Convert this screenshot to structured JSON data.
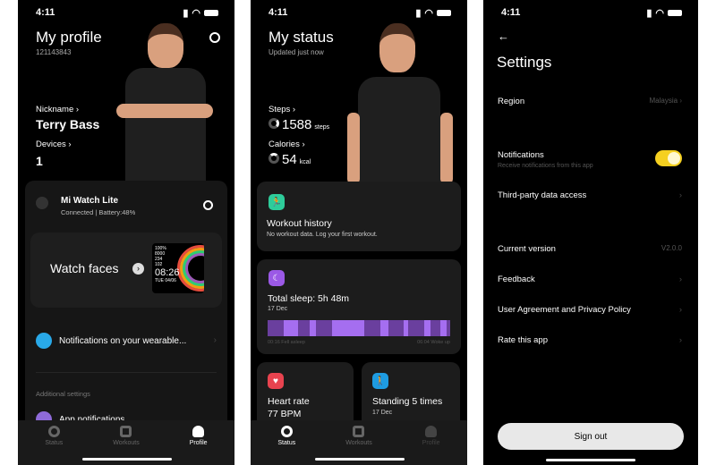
{
  "status_bar": {
    "time": "4:11"
  },
  "profile": {
    "title": "My profile",
    "user_id": "121143843",
    "nickname_label": "Nickname",
    "nickname": "Terry Bass",
    "devices_label": "Devices",
    "devices_count": "1",
    "device": {
      "name": "Mi Watch Lite",
      "status": "Connected | Battery:48%"
    },
    "watch_faces": {
      "label": "Watch faces",
      "preview": {
        "battery": "100%",
        "steps": "8000",
        "kcal": "234",
        "hr": "102",
        "time": "08:26",
        "date": "TUE 04/06"
      }
    },
    "notifications_label": "Notifications on your wearable...",
    "additional_label": "Additional settings",
    "app_notifications": "App notifications"
  },
  "status": {
    "title": "My status",
    "updated": "Updated just now",
    "steps_label": "Steps",
    "steps": "1588",
    "steps_unit": "steps",
    "calories_label": "Calories",
    "calories": "54",
    "calories_unit": "kcal",
    "workout": {
      "title": "Workout history",
      "sub": "No workout data. Log your first workout."
    },
    "sleep": {
      "title": "Total sleep: 5h 48m",
      "date": "17 Dec",
      "start": "00:16 Fell asleep",
      "end": "06:04 Woke up"
    },
    "heart": {
      "title": "Heart rate",
      "value": "77 BPM"
    },
    "standing": {
      "title": "Standing 5 times",
      "date": "17 Dec"
    }
  },
  "tabs": [
    {
      "label": "Status"
    },
    {
      "label": "Workouts"
    },
    {
      "label": "Profile"
    }
  ],
  "settings": {
    "title": "Settings",
    "region_label": "Region",
    "region_value": "Malaysia",
    "notifications_label": "Notifications",
    "notifications_sub": "Receive notifications from this app",
    "notifications_on": true,
    "third_party": "Third-party data access",
    "version_label": "Current version",
    "version_value": "V2.0.0",
    "feedback": "Feedback",
    "agreement": "User Agreement and Privacy Policy",
    "rate": "Rate this app",
    "sign_out": "Sign out"
  },
  "colors": {
    "toggle": "#f5d020",
    "sleep": "#9b59e6",
    "workout": "#2ecc9a",
    "heart": "#e8434f",
    "standing": "#1e9be0"
  }
}
